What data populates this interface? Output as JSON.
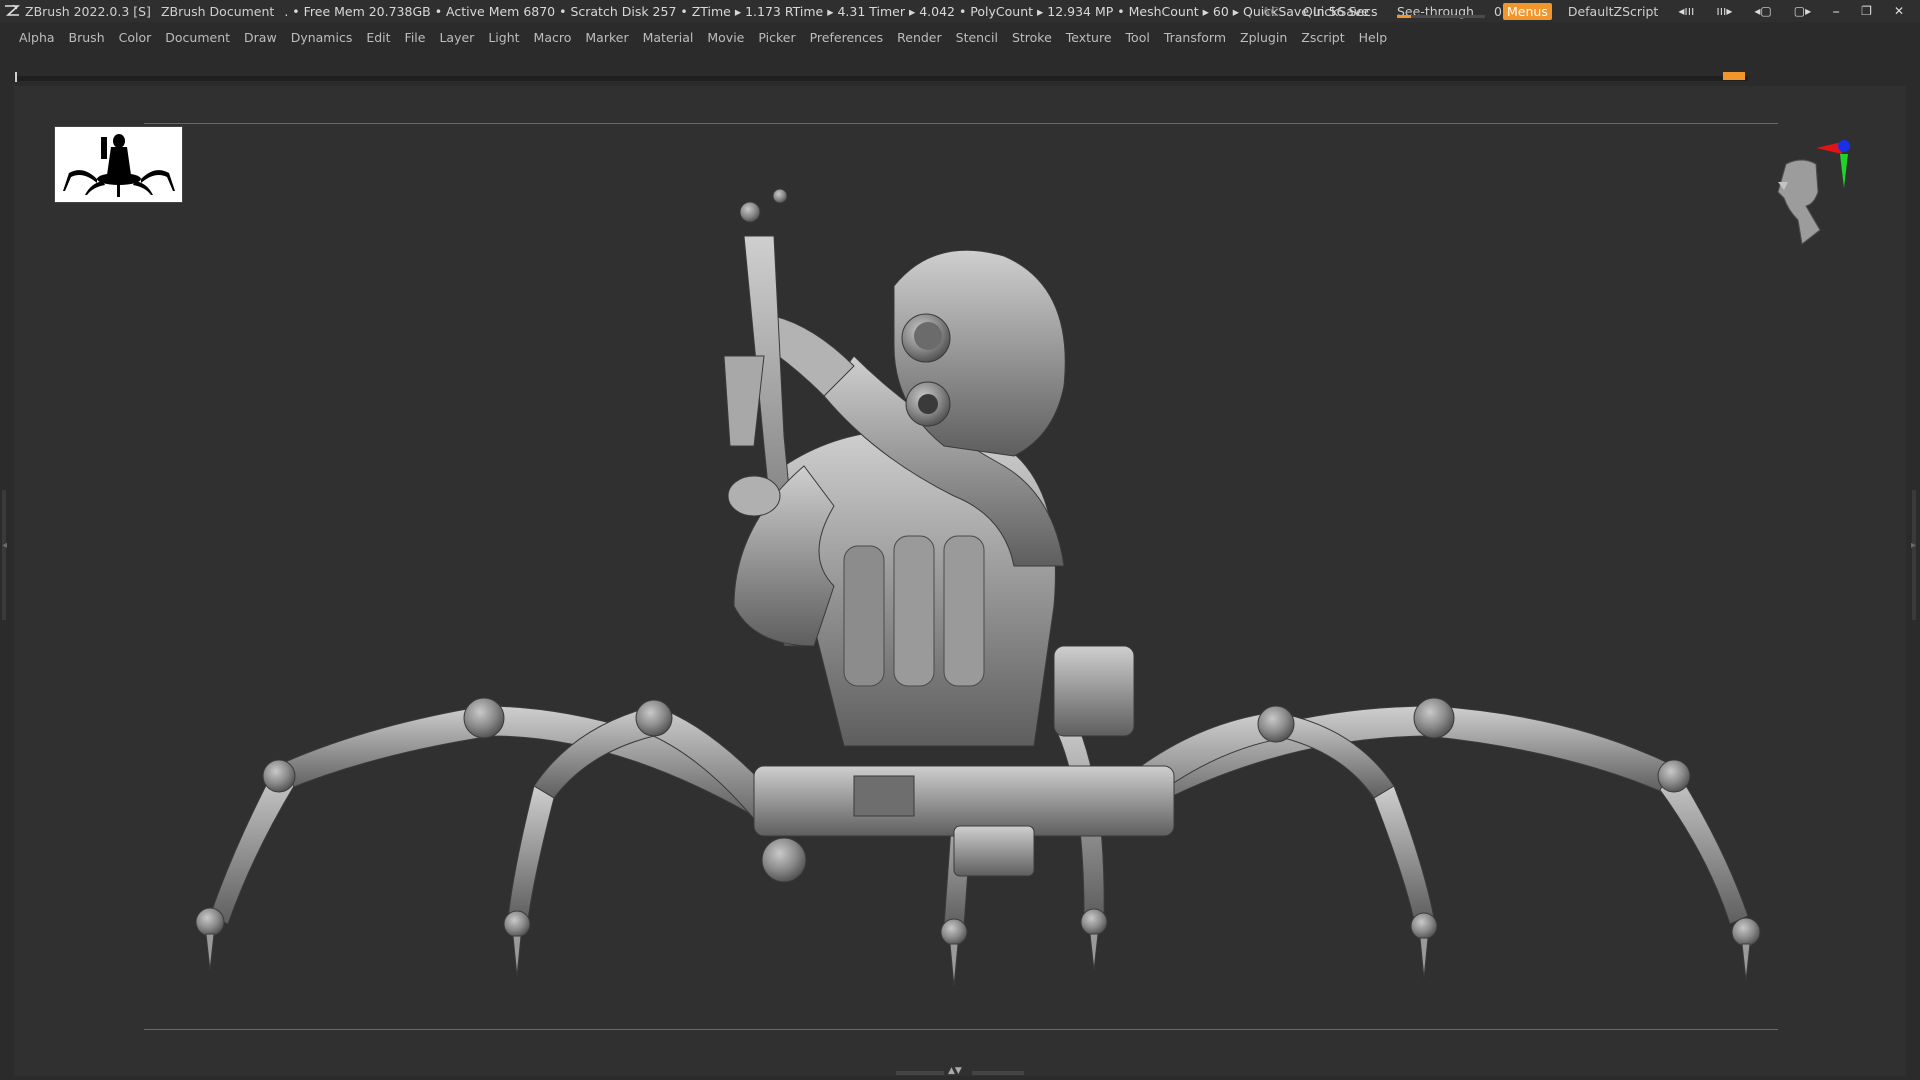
{
  "titlebar": {
    "app": "ZBrush 2022.0.3 [S]",
    "document": "ZBrush Document",
    "stats": ". • Free Mem 20.738GB • Active Mem 6870 • Scratch Disk 257 •  ZTime ▸ 1.173 RTime ▸ 4.31 Timer ▸ 4.042 • PolyCount ▸ 12.934 MP  • MeshCount ▸ 60  ▸ QuickSave In 56 Secs",
    "ac_label": "AC",
    "quicksave_label": "QuickSave",
    "seethrough_label": "See-through",
    "seethrough_value": "0",
    "seethrough_fraction": 0,
    "menus_label": "Menus",
    "script_label": "DefaultZScript",
    "accent_color": "#f0962a"
  },
  "menubar": {
    "items": [
      "Alpha",
      "Brush",
      "Color",
      "Document",
      "Draw",
      "Dynamics",
      "Edit",
      "File",
      "Layer",
      "Light",
      "Macro",
      "Marker",
      "Material",
      "Movie",
      "Picker",
      "Preferences",
      "Render",
      "Stencil",
      "Stroke",
      "Texture",
      "Tool",
      "Transform",
      "Zplugin",
      "Zscript",
      "Help"
    ]
  },
  "icons": {
    "app_logo": "zbrush-logo-icon",
    "gizmo": "navigation-gizmo-icon",
    "head": "orientation-head-icon"
  }
}
